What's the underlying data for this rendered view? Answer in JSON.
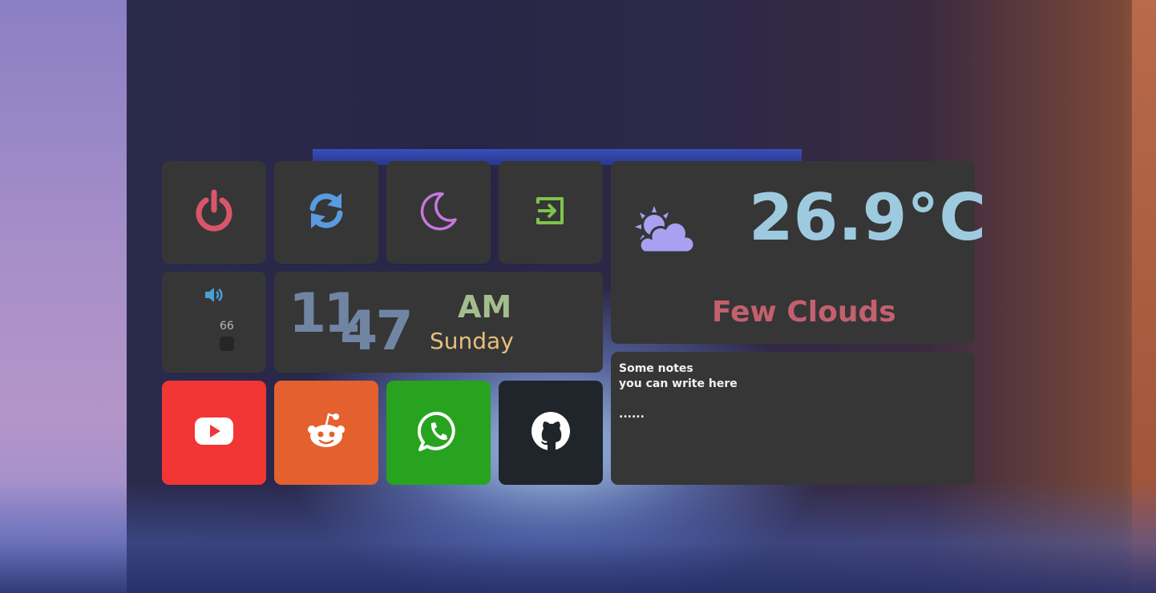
{
  "dashboard": {
    "actions": {
      "power": {
        "icon": "power-icon",
        "color": "#d9566a"
      },
      "reboot": {
        "icon": "refresh-icon",
        "color": "#5a9be0"
      },
      "sleep": {
        "icon": "moon-icon",
        "color": "#c678dd"
      },
      "logout": {
        "icon": "logout-icon",
        "color": "#7ec34a"
      }
    },
    "volume": {
      "icon": "speaker-icon",
      "value": "66",
      "color": "#4a9fd6"
    },
    "clock": {
      "hour": "11",
      "minute": "47",
      "ampm": "AM",
      "day": "Sunday"
    },
    "weather": {
      "icon": "cloud-sun-icon",
      "temperature": "26.9°C",
      "condition": "Few Clouds"
    },
    "notes": {
      "text": "Some notes\nyou can write here\n\n......"
    },
    "links": {
      "youtube": {
        "icon": "youtube-icon",
        "color": "#f23535"
      },
      "reddit": {
        "icon": "reddit-icon",
        "color": "#e5602f"
      },
      "whatsapp": {
        "icon": "whatsapp-icon",
        "color": "#28a31f"
      },
      "github": {
        "icon": "github-icon",
        "color": "#20252b"
      }
    }
  }
}
